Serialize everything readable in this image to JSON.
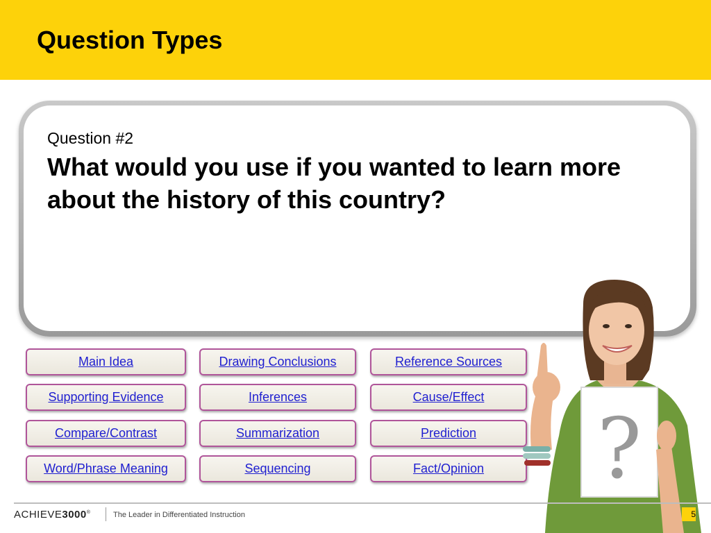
{
  "header": {
    "title": "Question Types"
  },
  "question": {
    "label": "Question #2",
    "text": "What would you use if you wanted to learn more about the history of this country?"
  },
  "buttons": [
    [
      "Main Idea",
      "Drawing Conclusions",
      "Reference Sources"
    ],
    [
      "Supporting Evidence",
      "Inferences",
      "Cause/Effect"
    ],
    [
      "Compare/Contrast",
      "Summarization",
      "Prediction"
    ],
    [
      "Word/Phrase Meaning",
      "Sequencing",
      "Fact/Opinion"
    ]
  ],
  "footer": {
    "logo_light": "ACHIEVE",
    "logo_bold": "3000",
    "logo_mark": "®",
    "tagline": "The Leader in Differentiated Instruction",
    "page_number": "5"
  },
  "illustration": {
    "sign_glyph": "?"
  },
  "colors": {
    "header": "#fdd20a",
    "link": "#1f1fd0",
    "button_border": "#b0559a"
  }
}
